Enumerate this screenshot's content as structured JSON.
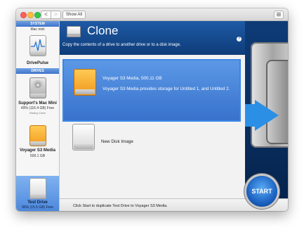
{
  "toolbar": {
    "back": "<",
    "forward": ">",
    "show_all": "Show All"
  },
  "sidebar": {
    "system_header": "SYSTEM",
    "system_name": "Mac mini",
    "app_name": "DrivePulse",
    "drives_header": "DRIVES",
    "drives": [
      {
        "name": "Support's Mac Mini",
        "detail": "49% (116.4 GB) Free",
        "note": "Startup Drive"
      },
      {
        "name": "Voyager S3 Media",
        "detail": "500.1 GB",
        "note": ""
      },
      {
        "name": "Test Drive",
        "detail": "96% (15.5 GB) Free",
        "note": ""
      }
    ]
  },
  "main": {
    "title": "Clone",
    "help": "?",
    "description": "Copy the contents of a drive to another drive or to a disk image.",
    "destination": {
      "name": "Voyager S3 Media, 500.11 GB",
      "description": "Voyager S3 Media provides storage for Untitled 1, and Untitled 2."
    },
    "source": {
      "name": "New Disk Image"
    }
  },
  "status": {
    "text": "Click Start to duplicate Test Drive to Voyager S3 Media."
  },
  "start_button": "START",
  "colors": {
    "accent": "#1e5aa5",
    "selection": "#4d88dd"
  }
}
